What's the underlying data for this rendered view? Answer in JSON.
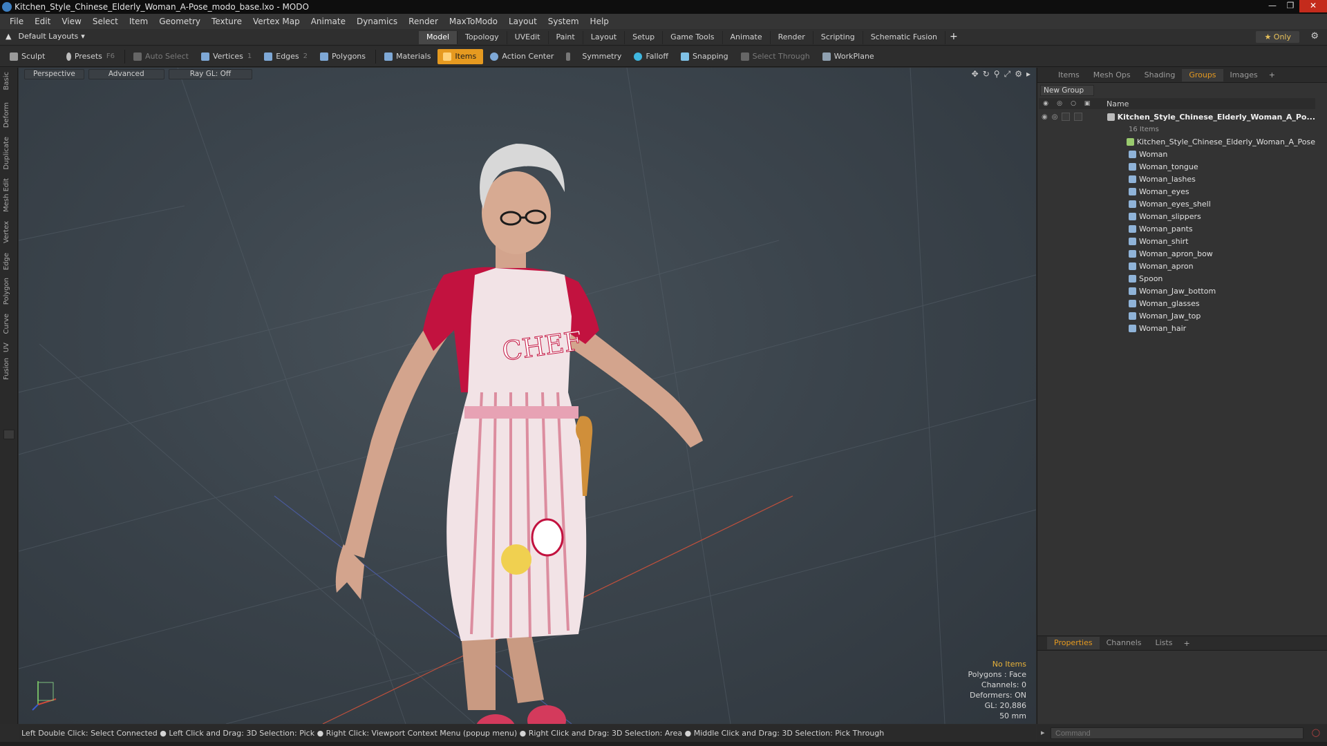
{
  "window": {
    "title": "Kitchen_Style_Chinese_Elderly_Woman_A-Pose_modo_base.lxo - MODO"
  },
  "menu": [
    "File",
    "Edit",
    "View",
    "Select",
    "Item",
    "Geometry",
    "Texture",
    "Vertex Map",
    "Animate",
    "Dynamics",
    "Render",
    "MaxToModo",
    "Layout",
    "System",
    "Help"
  ],
  "layoutbar": {
    "selector": "Default Layouts",
    "tabs": [
      "Model",
      "Topology",
      "UVEdit",
      "Paint",
      "Layout",
      "Setup",
      "Game Tools",
      "Animate",
      "Render",
      "Scripting",
      "Schematic Fusion"
    ],
    "active_tab": "Model",
    "only_label": "Only"
  },
  "toolbar": {
    "sculpt": "Sculpt",
    "presets": "Presets",
    "presets_key": "F6",
    "auto_select": "Auto Select",
    "vertices": "Vertices",
    "vertices_key": "1",
    "edges": "Edges",
    "edges_key": "2",
    "polygons": "Polygons",
    "materials": "Materials",
    "items": "Items",
    "action_center": "Action Center",
    "symmetry": "Symmetry",
    "falloff": "Falloff",
    "snapping": "Snapping",
    "select_through": "Select Through",
    "workplane": "WorkPlane"
  },
  "left_tabs": [
    "Basic",
    "Deform",
    "Duplicate",
    "Mesh Edit",
    "Vertex",
    "Edge",
    "Polygon",
    "Curve",
    "UV",
    "Fusion"
  ],
  "viewport": {
    "perspective": "Perspective",
    "advanced": "Advanced",
    "raygl": "Ray GL: Off",
    "info": {
      "no_items": "No Items",
      "polygons": "Polygons : Face",
      "channels": "Channels: 0",
      "deformers": "Deformers: ON",
      "gl": "GL: 20,886",
      "lens": "50 mm"
    },
    "colors": {
      "apron": "#f2e3e6",
      "shirt": "#c2123f",
      "skin": "#d8a890",
      "hair": "#d8d8d8"
    }
  },
  "right_panel": {
    "tabs": [
      "Items",
      "Mesh Ops",
      "Shading",
      "Groups",
      "Images"
    ],
    "active_tab": "Groups",
    "new_group": "New Group",
    "name_header": "Name",
    "group_name": "Kitchen_Style_Chinese_Elderly_Woman_A_Po...",
    "group_count": "16 Items",
    "items": [
      "Kitchen_Style_Chinese_Elderly_Woman_A_Pose",
      "Woman",
      "Woman_tongue",
      "Woman_lashes",
      "Woman_eyes",
      "Woman_eyes_shell",
      "Woman_slippers",
      "Woman_pants",
      "Woman_shirt",
      "Woman_apron_bow",
      "Woman_apron",
      "Spoon",
      "Woman_Jaw_bottom",
      "Woman_glasses",
      "Woman_Jaw_top",
      "Woman_hair"
    ],
    "lower_tabs": [
      "Properties",
      "Channels",
      "Lists"
    ],
    "lower_active": "Properties"
  },
  "statusbar": {
    "text": "Left Double Click: Select Connected ● Left Click and Drag: 3D Selection: Pick ● Right Click: Viewport Context Menu (popup menu) ● Right Click and Drag: 3D Selection: Area ● Middle Click and Drag: 3D Selection: Pick Through"
  },
  "command": {
    "placeholder": "Command"
  },
  "colors": {
    "accent": "#e69a20",
    "bg": "#2b2b2b"
  }
}
